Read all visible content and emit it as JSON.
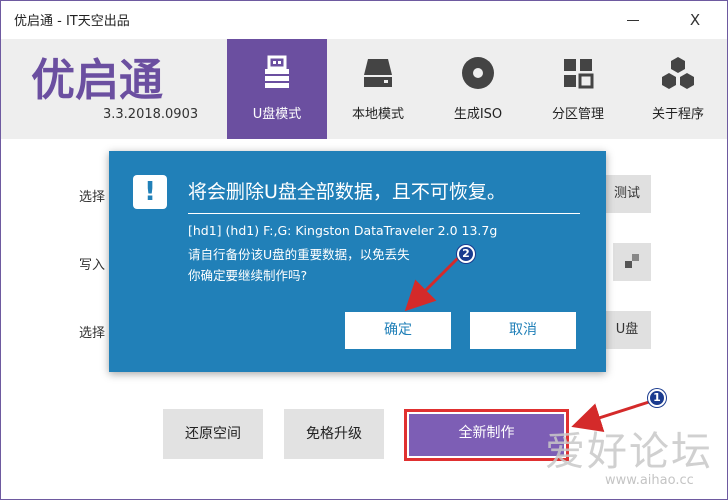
{
  "window": {
    "title": "优启通 - IT天空出品",
    "minimize_label": "—",
    "close_label": "X"
  },
  "header": {
    "logo_text": "优启通",
    "version": "3.3.2018.0903",
    "nav": [
      {
        "label": "U盘模式",
        "icon": "usb-drive-icon",
        "active": true
      },
      {
        "label": "本地模式",
        "icon": "hard-drive-icon",
        "active": false
      },
      {
        "label": "生成ISO",
        "icon": "disc-icon",
        "active": false
      },
      {
        "label": "分区管理",
        "icon": "partition-grid-icon",
        "active": false
      },
      {
        "label": "关于程序",
        "icon": "hexagons-icon",
        "active": false
      }
    ],
    "active_color": "#6b4fa0"
  },
  "main": {
    "rows": [
      {
        "label": "选择",
        "side_button": "测试"
      },
      {
        "label": "写入",
        "side_button": ""
      },
      {
        "label": "选择",
        "side_button": "U盘"
      }
    ],
    "buttons": {
      "restore": "还原空间",
      "upgrade": "免格升级",
      "create": "全新制作"
    }
  },
  "dialog": {
    "title": "将会删除U盘全部数据，且不可恢复。",
    "device_line": "[hd1] (hd1) F:,G: Kingston DataTraveler 2.0 13.7g",
    "backup_line": "请自行备份该U盘的重要数据，以免丢失",
    "confirm_line": "你确定要继续制作吗?",
    "ok_label": "确定",
    "cancel_label": "取消",
    "bg_color": "#2180b8"
  },
  "annotations": {
    "marker_1": "1",
    "marker_2": "2",
    "arrow_color": "#d42a2a"
  },
  "watermark": {
    "main": "爱好论坛",
    "sub": "www.aihao.cc"
  }
}
